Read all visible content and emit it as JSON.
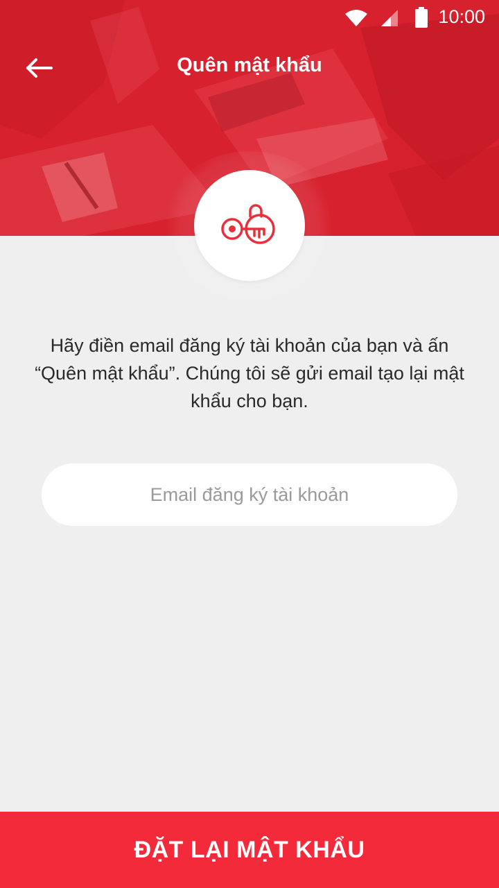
{
  "status_bar": {
    "time": "10:00",
    "icons": [
      "wifi-icon",
      "signal-icon",
      "battery-icon"
    ]
  },
  "app_bar": {
    "title": "Quên mật khẩu",
    "back_icon": "arrow-left-icon"
  },
  "badge": {
    "icon": "key-lock-icon"
  },
  "instructions": "Hãy điền email đăng ký tài khoản của bạn và ấn “Quên mật khẩu”. Chúng tôi sẽ gửi email tạo lại mật khẩu cho bạn.",
  "email_field": {
    "value": "",
    "placeholder": "Email đăng ký tài khoản"
  },
  "submit_button": {
    "label": "ĐẶT LẠI MẬT KHẨU"
  },
  "colors": {
    "header_red": "#d9232f",
    "button_red": "#f22a39",
    "background": "#efefef",
    "icon_red": "#e8303d"
  }
}
